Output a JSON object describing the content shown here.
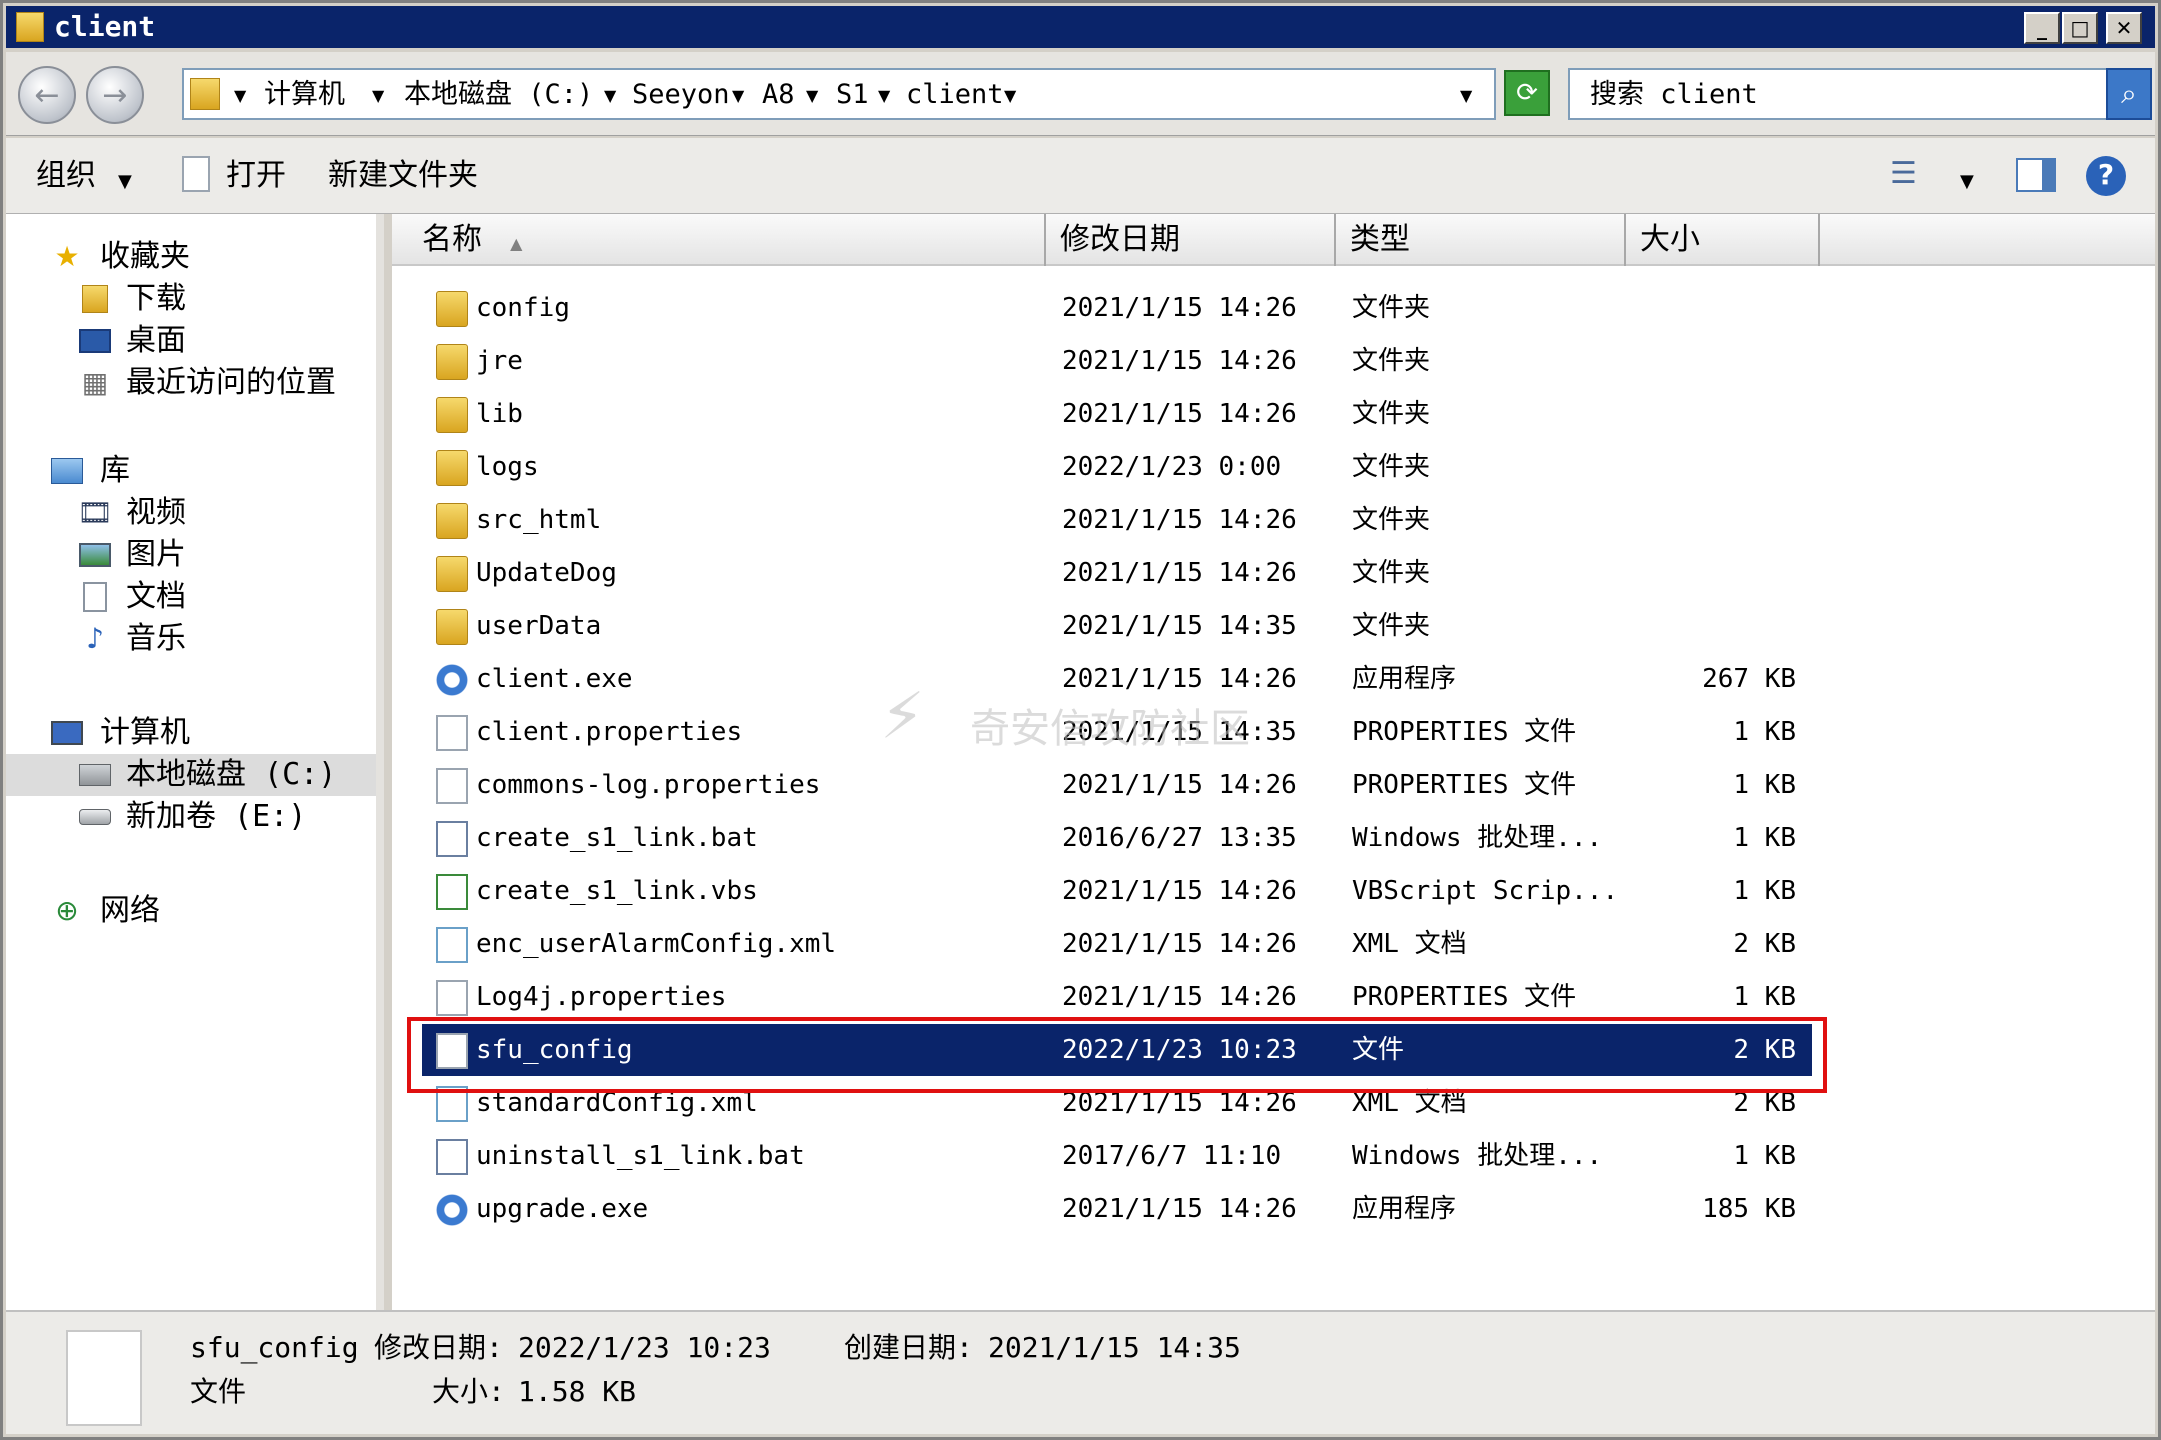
{
  "window": {
    "title": "client"
  },
  "address": {
    "crumbs": [
      "计算机",
      "本地磁盘 (C:)",
      "Seeyon",
      "A8",
      "S1",
      "client"
    ]
  },
  "search": {
    "text": "搜索 client"
  },
  "toolbar": {
    "organize": "组织",
    "open": "打开",
    "new_folder": "新建文件夹"
  },
  "nav": {
    "favorites": "收藏夹",
    "downloads": "下载",
    "desktop": "桌面",
    "recent": "最近访问的位置",
    "libraries": "库",
    "videos": "视频",
    "pictures": "图片",
    "documents": "文档",
    "music": "音乐",
    "computer": "计算机",
    "local_disk": "本地磁盘 (C:)",
    "new_volume": "新加卷 (E:)",
    "network": "网络"
  },
  "columns": {
    "name": "名称",
    "modified": "修改日期",
    "type": "类型",
    "size": "大小"
  },
  "files": [
    {
      "name": "config",
      "modified": "2021/1/15 14:26",
      "type": "文件夹",
      "size": "",
      "icon": "folder"
    },
    {
      "name": "jre",
      "modified": "2021/1/15 14:26",
      "type": "文件夹",
      "size": "",
      "icon": "folder"
    },
    {
      "name": "lib",
      "modified": "2021/1/15 14:26",
      "type": "文件夹",
      "size": "",
      "icon": "folder"
    },
    {
      "name": "logs",
      "modified": "2022/1/23 0:00",
      "type": "文件夹",
      "size": "",
      "icon": "folder"
    },
    {
      "name": "src_html",
      "modified": "2021/1/15 14:26",
      "type": "文件夹",
      "size": "",
      "icon": "folder"
    },
    {
      "name": "UpdateDog",
      "modified": "2021/1/15 14:26",
      "type": "文件夹",
      "size": "",
      "icon": "folder"
    },
    {
      "name": "userData",
      "modified": "2021/1/15 14:35",
      "type": "文件夹",
      "size": "",
      "icon": "folder"
    },
    {
      "name": "client.exe",
      "modified": "2021/1/15 14:26",
      "type": "应用程序",
      "size": "267 KB",
      "icon": "exe"
    },
    {
      "name": "client.properties",
      "modified": "2021/1/15 14:35",
      "type": "PROPERTIES 文件",
      "size": "1 KB",
      "icon": "doc"
    },
    {
      "name": "commons-log.properties",
      "modified": "2021/1/15 14:26",
      "type": "PROPERTIES 文件",
      "size": "1 KB",
      "icon": "doc"
    },
    {
      "name": "create_s1_link.bat",
      "modified": "2016/6/27 13:35",
      "type": "Windows 批处理...",
      "size": "1 KB",
      "icon": "bat"
    },
    {
      "name": "create_s1_link.vbs",
      "modified": "2021/1/15 14:26",
      "type": "VBScript Scrip...",
      "size": "1 KB",
      "icon": "vbs"
    },
    {
      "name": "enc_userAlarmConfig.xml",
      "modified": "2021/1/15 14:26",
      "type": "XML 文档",
      "size": "2 KB",
      "icon": "xml"
    },
    {
      "name": "Log4j.properties",
      "modified": "2021/1/15 14:26",
      "type": "PROPERTIES 文件",
      "size": "1 KB",
      "icon": "doc"
    },
    {
      "name": "sfu_config",
      "modified": "2022/1/23 10:23",
      "type": "文件",
      "size": "2 KB",
      "icon": "doc",
      "selected": true
    },
    {
      "name": "standardConfig.xml",
      "modified": "2021/1/15 14:26",
      "type": "XML 文档",
      "size": "2 KB",
      "icon": "xml"
    },
    {
      "name": "uninstall_s1_link.bat",
      "modified": "2017/6/7 11:10",
      "type": "Windows 批处理...",
      "size": "1 KB",
      "icon": "bat"
    },
    {
      "name": "upgrade.exe",
      "modified": "2021/1/15 14:26",
      "type": "应用程序",
      "size": "185 KB",
      "icon": "exe"
    }
  ],
  "watermark": {
    "text": "奇安信攻防社区"
  },
  "details": {
    "name": "sfu_config",
    "modified_label": "修改日期:",
    "modified": "2022/1/23 10:23",
    "created_label": "创建日期:",
    "created": "2021/1/15 14:35",
    "type": "文件",
    "size_label": "大小:",
    "size": "1.58 KB"
  },
  "colors": {
    "titlebar": "#0a246a",
    "selection": "#0a246a",
    "highlight_box": "#e01010"
  }
}
